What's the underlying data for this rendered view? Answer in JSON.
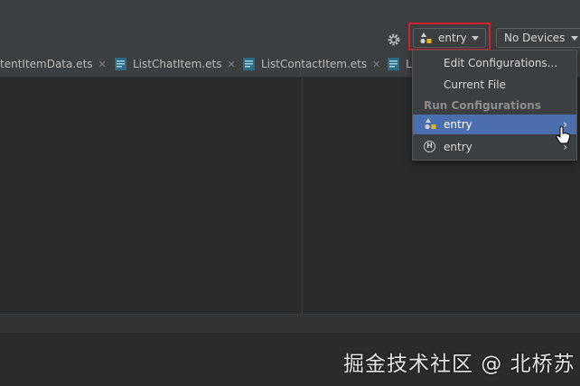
{
  "toolbar": {
    "run_config": "entry",
    "devices": "No Devices"
  },
  "tabs": [
    {
      "label": "tentItemData.ets"
    },
    {
      "label": "ListChatItem.ets"
    },
    {
      "label": "ListContactItem.ets"
    },
    {
      "label": "L"
    }
  ],
  "menu": {
    "edit_config": "Edit Configurations...",
    "current_file": "Current File",
    "header": "Run Configurations",
    "entry_app": "entry",
    "entry_h": "entry",
    "h_badge": "H"
  },
  "watermark": "掘金技术社区 @ 北桥苏",
  "colors": {
    "selection": "#4b6eaf",
    "highlight_box": "#d2232a",
    "background": "#2b2b2b"
  }
}
